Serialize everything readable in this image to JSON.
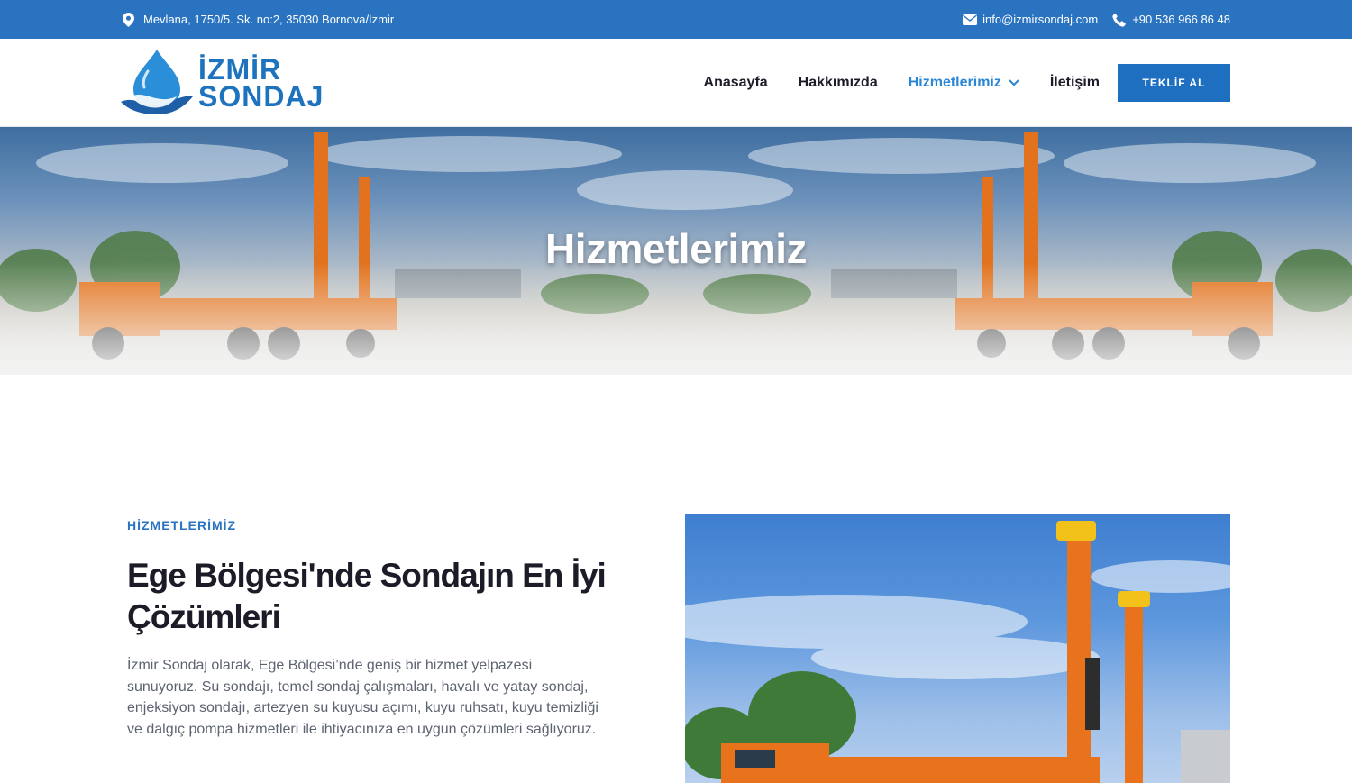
{
  "topbar": {
    "address": "Mevlana, 1750/5. Sk. no:2, 35030 Bornova/İzmir",
    "email": "info@izmirsondaj.com",
    "phone": "+90 536 966 86 48"
  },
  "header": {
    "logo_line1": "İZMİR",
    "logo_line2": "SONDAJ",
    "nav": [
      {
        "label": "Anasayfa"
      },
      {
        "label": "Hakkımızda"
      },
      {
        "label": "Hizmetlerimiz"
      },
      {
        "label": "İletişim"
      }
    ],
    "cta_label": "TEKLİF AL"
  },
  "hero": {
    "title": "Hizmetlerimiz"
  },
  "content": {
    "label": "HİZMETLERİMİZ",
    "title": "Ege Bölgesi'nde Sondajın En İyi Çözümleri",
    "text": "İzmir Sondaj olarak, Ege Bölgesi’nde geniş bir hizmet yelpazesi sunuyoruz. Su sondajı, temel sondaj çalışmaları, havalı ve yatay sondaj, enjeksiyon sondajı, artezyen su kuyusu açımı, kuyu ruhsatı, kuyu temizliği ve dalgıç pompa hizmetleri ile ihtiyacınıza en uygun çözümleri sağlıyoruz."
  },
  "colors": {
    "topbar": "#2a73c0",
    "accent": "#1f6fc0",
    "nav_active": "#2a86d6",
    "heading": "#1c1c28",
    "body_text": "#5d6370"
  },
  "icons": [
    "map-pin-icon",
    "envelope-icon",
    "phone-icon",
    "chevron-down-icon",
    "water-drop-logo-icon"
  ]
}
